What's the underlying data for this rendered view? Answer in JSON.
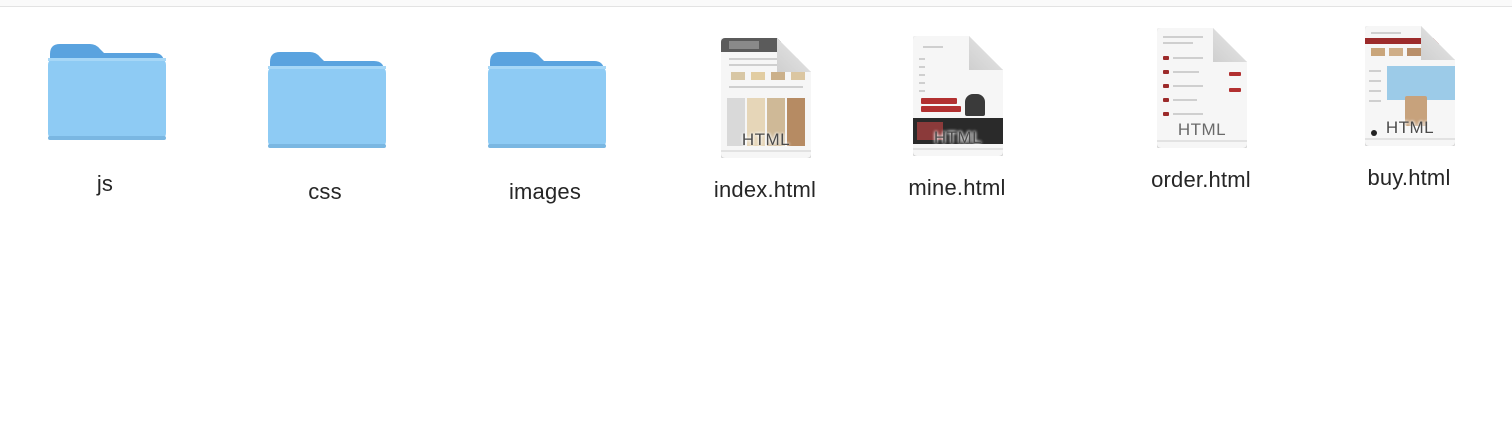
{
  "files": [
    {
      "name": "js",
      "kind": "folder",
      "icon": "folder-icon"
    },
    {
      "name": "css",
      "kind": "folder",
      "icon": "folder-icon"
    },
    {
      "name": "images",
      "kind": "folder",
      "icon": "folder-icon"
    },
    {
      "name": "index.html",
      "kind": "html",
      "icon": "html-document-icon",
      "badge": "HTML"
    },
    {
      "name": "mine.html",
      "kind": "html",
      "icon": "html-document-icon",
      "badge": "HTML"
    },
    {
      "name": "order.html",
      "kind": "html",
      "icon": "html-document-icon",
      "badge": "HTML"
    },
    {
      "name": "buy.html",
      "kind": "html",
      "icon": "html-document-icon",
      "badge": "HTML"
    }
  ],
  "colors": {
    "folder_front": "#8ecbf4",
    "folder_back": "#5aa3df",
    "thumbnail_accent": "#b23030"
  }
}
